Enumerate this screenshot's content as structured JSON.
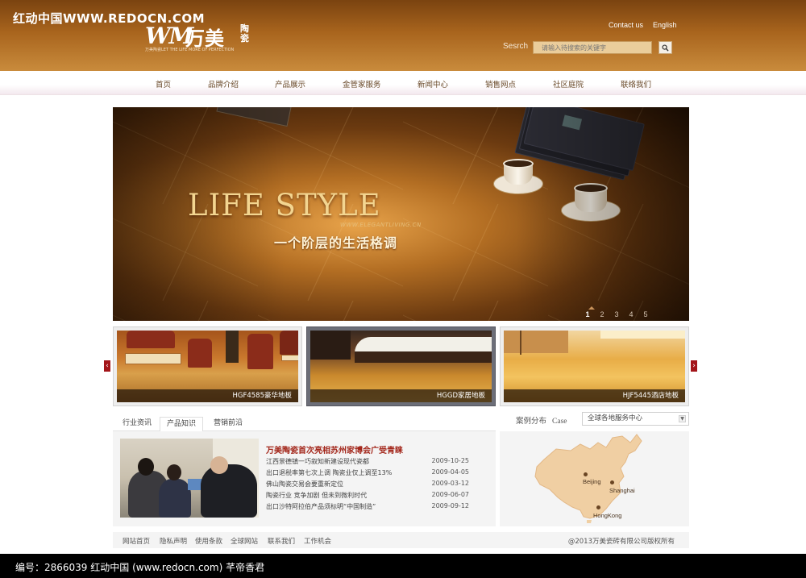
{
  "watermark_top": "红动中国WWW.REDOCN.COM",
  "logo": {
    "mark": "WM",
    "name_cn": "万美",
    "name_cn2": "陶瓷",
    "slogan": "万美陶瓷LET THE LIFE MORE OF PERFECTION"
  },
  "header": {
    "contact": "Contact us",
    "english": "English"
  },
  "search": {
    "label": "Sesrch",
    "placeholder": "请输入待搜索的关键字"
  },
  "nav": [
    "首页",
    "品牌介绍",
    "产品展示",
    "金管家服务",
    "新闻中心",
    "销售网点",
    "社区庭院",
    "联络我们"
  ],
  "banner": {
    "headline": "LIFE STYLE",
    "url": "WWW.ELEGANTLIVING.CN",
    "sub": "一个阶层的生活格调",
    "pages": [
      "1",
      "2",
      "3",
      "4",
      "5"
    ],
    "active_page": "1"
  },
  "thumbs": [
    {
      "caption": "HGF4585豪华地板"
    },
    {
      "caption": "HGGD家居地板"
    },
    {
      "caption": "HJF5445酒店地板"
    }
  ],
  "tabs": [
    "行业资讯",
    "产品知识",
    "营销前沿"
  ],
  "active_tab": "产品知识",
  "news": {
    "headline": "万美陶瓷首次亮相苏州家博会广受青睐",
    "items": [
      {
        "title": "江西景德镇一巧叙知新建设现代瓷都",
        "date": "2009-10-25"
      },
      {
        "title": "出口退税率第七次上调 陶瓷业仅上调至13%",
        "date": "2009-04-05"
      },
      {
        "title": "佛山陶瓷交易会要重新定位",
        "date": "2009-03-12"
      },
      {
        "title": "陶瓷行业  竞争加剧 但未到微利时代",
        "date": "2009-06-07"
      },
      {
        "title": "出口沙特阿拉伯产品须标明“中国制造”",
        "date": "2009-09-12"
      }
    ]
  },
  "case": {
    "label": "案例分布",
    "label_en": "Case",
    "select": "全球各地服务中心"
  },
  "map": {
    "cities": [
      "Beijing",
      "Shanghai",
      "HongKong"
    ],
    "land_color": "#f0cfa3"
  },
  "footer": {
    "links": [
      "网站首页",
      "隐私声明",
      "使用条款",
      "全球网站",
      "联系我们",
      "工作机会"
    ],
    "copyright": "@2013万美瓷砖有限公司版权所有"
  },
  "watermark_bar": "编号：2866039    红动中国 (www.redocn.com)    芊帝香君",
  "colors": {
    "header": "#a8641d",
    "accent_red": "#a3271b",
    "nav_text": "#6a4a2a"
  }
}
